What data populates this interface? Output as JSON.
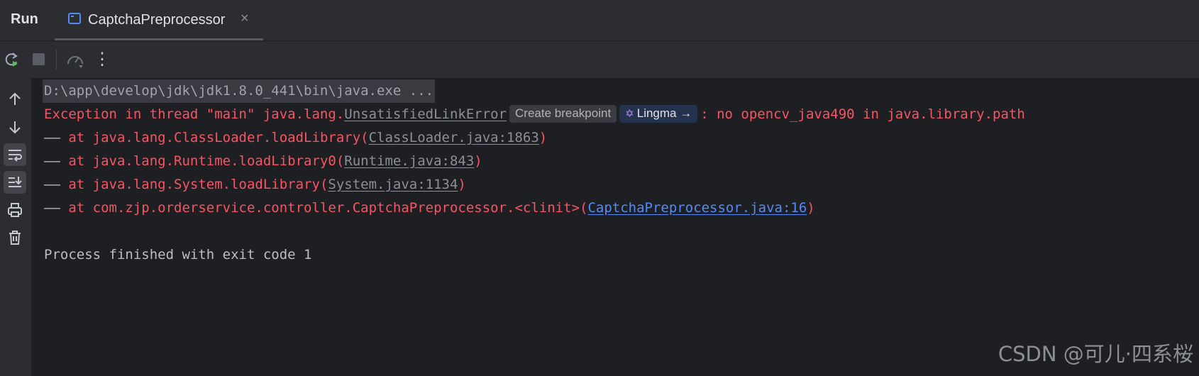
{
  "header": {
    "run_label": "Run",
    "tab_label": "CaptchaPreprocessor",
    "tab_close": "×",
    "tab_icon": "console-window-icon"
  },
  "toolbar": {
    "buttons": [
      "rerun-icon",
      "stop-icon",
      "profiler-icon",
      "more-options-icon"
    ],
    "more_glyph": "⋮"
  },
  "sidebar": {
    "buttons": [
      "arrow-up-icon",
      "arrow-down-icon",
      "soft-wrap-icon",
      "scroll-to-end-icon",
      "print-icon",
      "trash-icon"
    ]
  },
  "console": {
    "command": "D:\\app\\develop\\jdk\\jdk1.8.0_441\\bin\\java.exe ...",
    "exception_prefix": "Exception in thread \"main\" java.lang.",
    "exception_class": "UnsatisfiedLinkError",
    "create_breakpoint": "Create breakpoint",
    "lingma_label": "Lingma →",
    "exception_message": ": no opencv_java490 in java.library.path",
    "dash": "——",
    "stack": [
      {
        "method": " at java.lang.ClassLoader.loadLibrary(",
        "source": "ClassLoader.java:1863",
        "close": ")"
      },
      {
        "method": " at java.lang.Runtime.loadLibrary0(",
        "source": "Runtime.java:843",
        "close": ")"
      },
      {
        "method": " at java.lang.System.loadLibrary(",
        "source": "System.java:1134",
        "close": ")"
      },
      {
        "method": " at com.zjp.orderservice.controller.CaptchaPreprocessor.<clinit>(",
        "source": "CaptchaPreprocessor.java:16",
        "close": ")"
      }
    ],
    "exit_message": "Process finished with exit code 1"
  },
  "watermark": "CSDN @可儿·四系桜",
  "colors": {
    "background": "#1e1f22",
    "panel": "#2b2d30",
    "error": "#f75464",
    "link": "#548af7",
    "text": "#bcbec4"
  }
}
